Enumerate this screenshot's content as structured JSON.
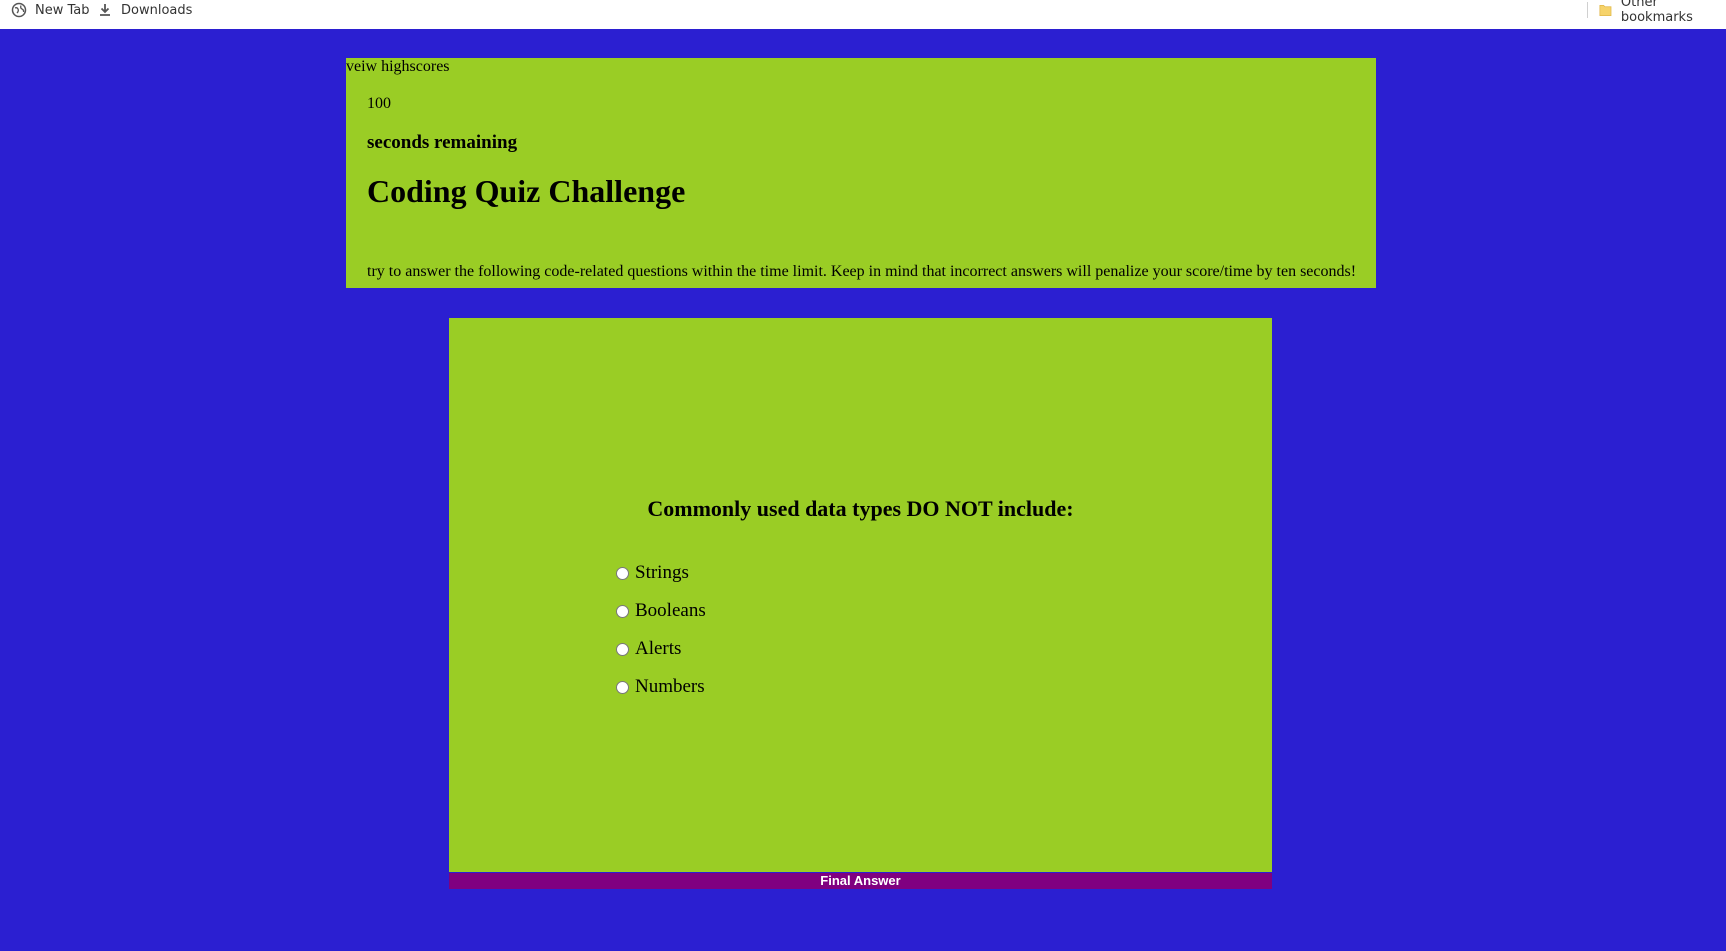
{
  "bookmarks": {
    "new_tab": "New Tab",
    "downloads": "Downloads",
    "other": "Other bookmarks"
  },
  "header": {
    "view_highscores": "veiw highscores",
    "timer_value": "100",
    "timer_label": "seconds remaining",
    "title": "Coding Quiz Challenge",
    "description": "try to answer the following code-related questions within the time limit. Keep in mind that incorrect answers will penalize your score/time by ten seconds!"
  },
  "question": {
    "text": "Commonly used data types DO NOT include:",
    "options": [
      "Strings",
      "Booleans",
      "Alerts",
      "Numbers"
    ]
  },
  "submit": {
    "label": "Final Answer"
  },
  "colors": {
    "page_bg": "#2b1fd1",
    "panel_bg": "#9acd25",
    "button_bg": "#800080"
  },
  "icons": {
    "new_tab": "globe-icon",
    "downloads": "download-icon",
    "other": "folder-icon"
  }
}
